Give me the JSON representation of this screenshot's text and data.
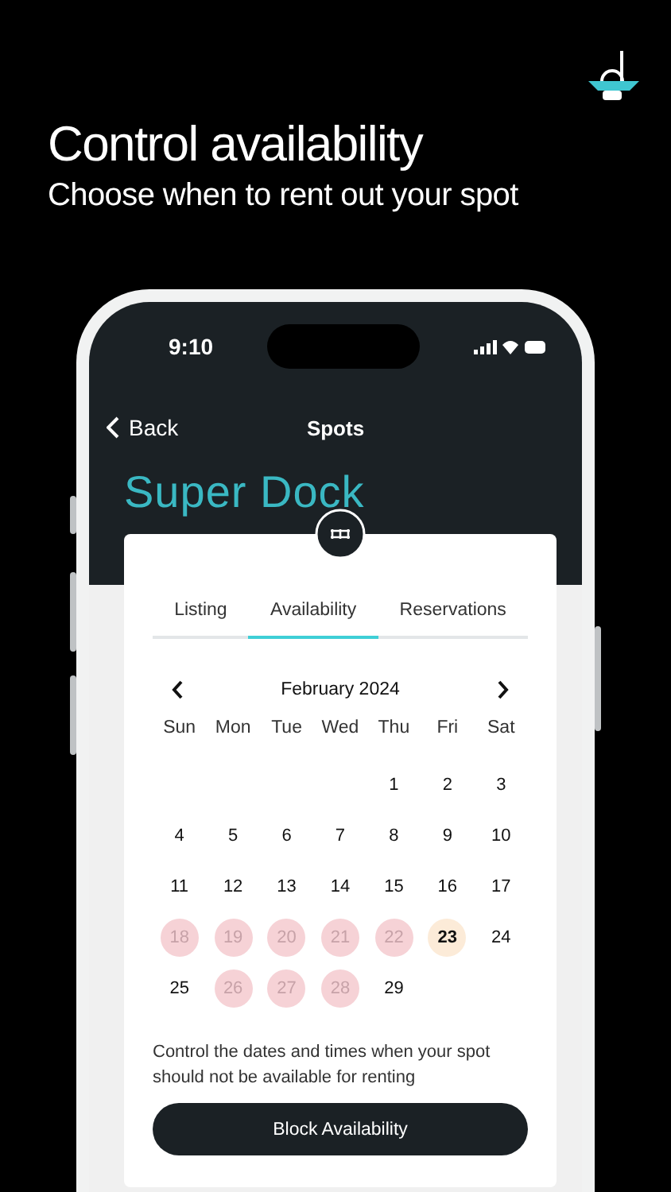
{
  "headline": "Control availability",
  "subheadline": "Choose when to rent out your spot",
  "status_bar": {
    "time": "9:10"
  },
  "nav": {
    "back": "Back",
    "title": "Spots"
  },
  "spot_name": "Super Dock",
  "tabs": [
    {
      "label": "Listing",
      "selected": false
    },
    {
      "label": "Availability",
      "selected": true
    },
    {
      "label": "Reservations",
      "selected": false
    }
  ],
  "calendar": {
    "month": "February 2024",
    "weekdays": [
      "Sun",
      "Mon",
      "Tue",
      "Wed",
      "Thu",
      "Fri",
      "Sat"
    ],
    "days": [
      {
        "label": "1",
        "blocked": false,
        "highlighted": false
      },
      {
        "label": "2",
        "blocked": false,
        "highlighted": false
      },
      {
        "label": "3",
        "blocked": false,
        "highlighted": false
      },
      {
        "label": "4",
        "blocked": false,
        "highlighted": false
      },
      {
        "label": "5",
        "blocked": false,
        "highlighted": false
      },
      {
        "label": "6",
        "blocked": false,
        "highlighted": false
      },
      {
        "label": "7",
        "blocked": false,
        "highlighted": false
      },
      {
        "label": "8",
        "blocked": false,
        "highlighted": false
      },
      {
        "label": "9",
        "blocked": false,
        "highlighted": false
      },
      {
        "label": "10",
        "blocked": false,
        "highlighted": false
      },
      {
        "label": "11",
        "blocked": false,
        "highlighted": false
      },
      {
        "label": "12",
        "blocked": false,
        "highlighted": false
      },
      {
        "label": "13",
        "blocked": false,
        "highlighted": false
      },
      {
        "label": "14",
        "blocked": false,
        "highlighted": false
      },
      {
        "label": "15",
        "blocked": false,
        "highlighted": false
      },
      {
        "label": "16",
        "blocked": false,
        "highlighted": false
      },
      {
        "label": "17",
        "blocked": false,
        "highlighted": false
      },
      {
        "label": "18",
        "blocked": true,
        "highlighted": false
      },
      {
        "label": "19",
        "blocked": true,
        "highlighted": false
      },
      {
        "label": "20",
        "blocked": true,
        "highlighted": false
      },
      {
        "label": "21",
        "blocked": true,
        "highlighted": false
      },
      {
        "label": "22",
        "blocked": true,
        "highlighted": false
      },
      {
        "label": "23",
        "blocked": false,
        "highlighted": true
      },
      {
        "label": "24",
        "blocked": false,
        "highlighted": false
      },
      {
        "label": "25",
        "blocked": false,
        "highlighted": false
      },
      {
        "label": "26",
        "blocked": true,
        "highlighted": false
      },
      {
        "label": "27",
        "blocked": true,
        "highlighted": false
      },
      {
        "label": "28",
        "blocked": true,
        "highlighted": false
      },
      {
        "label": "29",
        "blocked": false,
        "highlighted": false
      }
    ]
  },
  "description": "Control the dates and times when your spot should not be available for renting",
  "action_button": "Block Availability"
}
